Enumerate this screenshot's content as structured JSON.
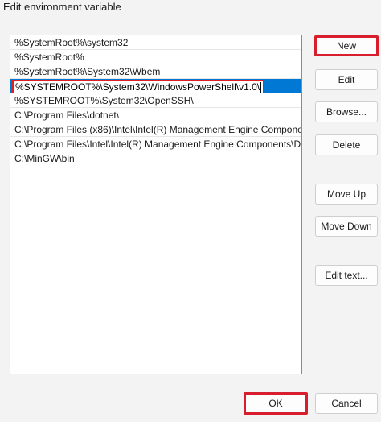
{
  "window": {
    "title": "Edit environment variable"
  },
  "list": {
    "items": [
      "%SystemRoot%\\system32",
      "%SystemRoot%",
      "%SystemRoot%\\System32\\Wbem",
      "%SYSTEMROOT%\\System32\\WindowsPowerShell\\v1.0\\",
      "%SYSTEMROOT%\\System32\\OpenSSH\\",
      "C:\\Program Files\\dotnet\\",
      "C:\\Program Files (x86)\\Intel\\Intel(R) Management Engine Compone...",
      "C:\\Program Files\\Intel\\Intel(R) Management Engine Components\\D...",
      "C:\\MinGW\\bin"
    ],
    "selected_index": 3
  },
  "buttons": {
    "new": "New",
    "edit": "Edit",
    "browse": "Browse...",
    "delete": "Delete",
    "move_up": "Move Up",
    "move_down": "Move Down",
    "edit_text": "Edit text...",
    "ok": "OK",
    "cancel": "Cancel"
  },
  "colors": {
    "selection": "#0078d4",
    "highlight_outline": "#d81e2c"
  }
}
